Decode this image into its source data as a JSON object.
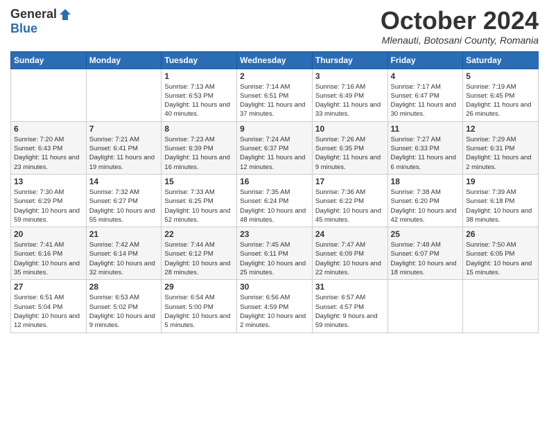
{
  "logo": {
    "general": "General",
    "blue": "Blue"
  },
  "header": {
    "month_title": "October 2024",
    "subtitle": "Mlenauti, Botosani County, Romania"
  },
  "weekdays": [
    "Sunday",
    "Monday",
    "Tuesday",
    "Wednesday",
    "Thursday",
    "Friday",
    "Saturday"
  ],
  "weeks": [
    [
      {
        "day": "",
        "info": ""
      },
      {
        "day": "",
        "info": ""
      },
      {
        "day": "1",
        "info": "Sunrise: 7:13 AM\nSunset: 6:53 PM\nDaylight: 11 hours and 40 minutes."
      },
      {
        "day": "2",
        "info": "Sunrise: 7:14 AM\nSunset: 6:51 PM\nDaylight: 11 hours and 37 minutes."
      },
      {
        "day": "3",
        "info": "Sunrise: 7:16 AM\nSunset: 6:49 PM\nDaylight: 11 hours and 33 minutes."
      },
      {
        "day": "4",
        "info": "Sunrise: 7:17 AM\nSunset: 6:47 PM\nDaylight: 11 hours and 30 minutes."
      },
      {
        "day": "5",
        "info": "Sunrise: 7:19 AM\nSunset: 6:45 PM\nDaylight: 11 hours and 26 minutes."
      }
    ],
    [
      {
        "day": "6",
        "info": "Sunrise: 7:20 AM\nSunset: 6:43 PM\nDaylight: 11 hours and 23 minutes."
      },
      {
        "day": "7",
        "info": "Sunrise: 7:21 AM\nSunset: 6:41 PM\nDaylight: 11 hours and 19 minutes."
      },
      {
        "day": "8",
        "info": "Sunrise: 7:23 AM\nSunset: 6:39 PM\nDaylight: 11 hours and 16 minutes."
      },
      {
        "day": "9",
        "info": "Sunrise: 7:24 AM\nSunset: 6:37 PM\nDaylight: 11 hours and 12 minutes."
      },
      {
        "day": "10",
        "info": "Sunrise: 7:26 AM\nSunset: 6:35 PM\nDaylight: 11 hours and 9 minutes."
      },
      {
        "day": "11",
        "info": "Sunrise: 7:27 AM\nSunset: 6:33 PM\nDaylight: 11 hours and 6 minutes."
      },
      {
        "day": "12",
        "info": "Sunrise: 7:29 AM\nSunset: 6:31 PM\nDaylight: 11 hours and 2 minutes."
      }
    ],
    [
      {
        "day": "13",
        "info": "Sunrise: 7:30 AM\nSunset: 6:29 PM\nDaylight: 10 hours and 59 minutes."
      },
      {
        "day": "14",
        "info": "Sunrise: 7:32 AM\nSunset: 6:27 PM\nDaylight: 10 hours and 55 minutes."
      },
      {
        "day": "15",
        "info": "Sunrise: 7:33 AM\nSunset: 6:25 PM\nDaylight: 10 hours and 52 minutes."
      },
      {
        "day": "16",
        "info": "Sunrise: 7:35 AM\nSunset: 6:24 PM\nDaylight: 10 hours and 48 minutes."
      },
      {
        "day": "17",
        "info": "Sunrise: 7:36 AM\nSunset: 6:22 PM\nDaylight: 10 hours and 45 minutes."
      },
      {
        "day": "18",
        "info": "Sunrise: 7:38 AM\nSunset: 6:20 PM\nDaylight: 10 hours and 42 minutes."
      },
      {
        "day": "19",
        "info": "Sunrise: 7:39 AM\nSunset: 6:18 PM\nDaylight: 10 hours and 38 minutes."
      }
    ],
    [
      {
        "day": "20",
        "info": "Sunrise: 7:41 AM\nSunset: 6:16 PM\nDaylight: 10 hours and 35 minutes."
      },
      {
        "day": "21",
        "info": "Sunrise: 7:42 AM\nSunset: 6:14 PM\nDaylight: 10 hours and 32 minutes."
      },
      {
        "day": "22",
        "info": "Sunrise: 7:44 AM\nSunset: 6:12 PM\nDaylight: 10 hours and 28 minutes."
      },
      {
        "day": "23",
        "info": "Sunrise: 7:45 AM\nSunset: 6:11 PM\nDaylight: 10 hours and 25 minutes."
      },
      {
        "day": "24",
        "info": "Sunrise: 7:47 AM\nSunset: 6:09 PM\nDaylight: 10 hours and 22 minutes."
      },
      {
        "day": "25",
        "info": "Sunrise: 7:48 AM\nSunset: 6:07 PM\nDaylight: 10 hours and 18 minutes."
      },
      {
        "day": "26",
        "info": "Sunrise: 7:50 AM\nSunset: 6:05 PM\nDaylight: 10 hours and 15 minutes."
      }
    ],
    [
      {
        "day": "27",
        "info": "Sunrise: 6:51 AM\nSunset: 5:04 PM\nDaylight: 10 hours and 12 minutes."
      },
      {
        "day": "28",
        "info": "Sunrise: 6:53 AM\nSunset: 5:02 PM\nDaylight: 10 hours and 9 minutes."
      },
      {
        "day": "29",
        "info": "Sunrise: 6:54 AM\nSunset: 5:00 PM\nDaylight: 10 hours and 5 minutes."
      },
      {
        "day": "30",
        "info": "Sunrise: 6:56 AM\nSunset: 4:59 PM\nDaylight: 10 hours and 2 minutes."
      },
      {
        "day": "31",
        "info": "Sunrise: 6:57 AM\nSunset: 4:57 PM\nDaylight: 9 hours and 59 minutes."
      },
      {
        "day": "",
        "info": ""
      },
      {
        "day": "",
        "info": ""
      }
    ]
  ]
}
